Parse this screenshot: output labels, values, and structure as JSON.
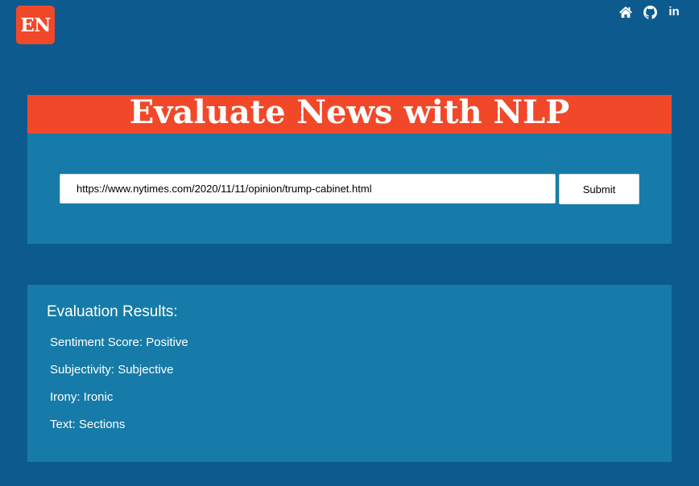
{
  "header": {
    "logo_text": "EN",
    "nav": [
      {
        "icon": "home-icon"
      },
      {
        "icon": "github-icon"
      },
      {
        "icon": "linkedin-icon",
        "text": "in"
      }
    ]
  },
  "form": {
    "title": "Evaluate News with NLP",
    "url_value": "https://www.nytimes.com/2020/11/11/opinion/trump-cabinet.html",
    "submit_label": "Submit"
  },
  "results": {
    "heading": "Evaluation Results:",
    "sentiment": "Sentiment Score: Positive",
    "subjectivity": "Subjectivity: Subjective",
    "irony": "Irony: Ironic",
    "text": "Text: Sections"
  },
  "colors": {
    "background": "#0d5b8e",
    "panel": "#167ba8",
    "accent": "#f1482a",
    "text": "#ffffff"
  }
}
